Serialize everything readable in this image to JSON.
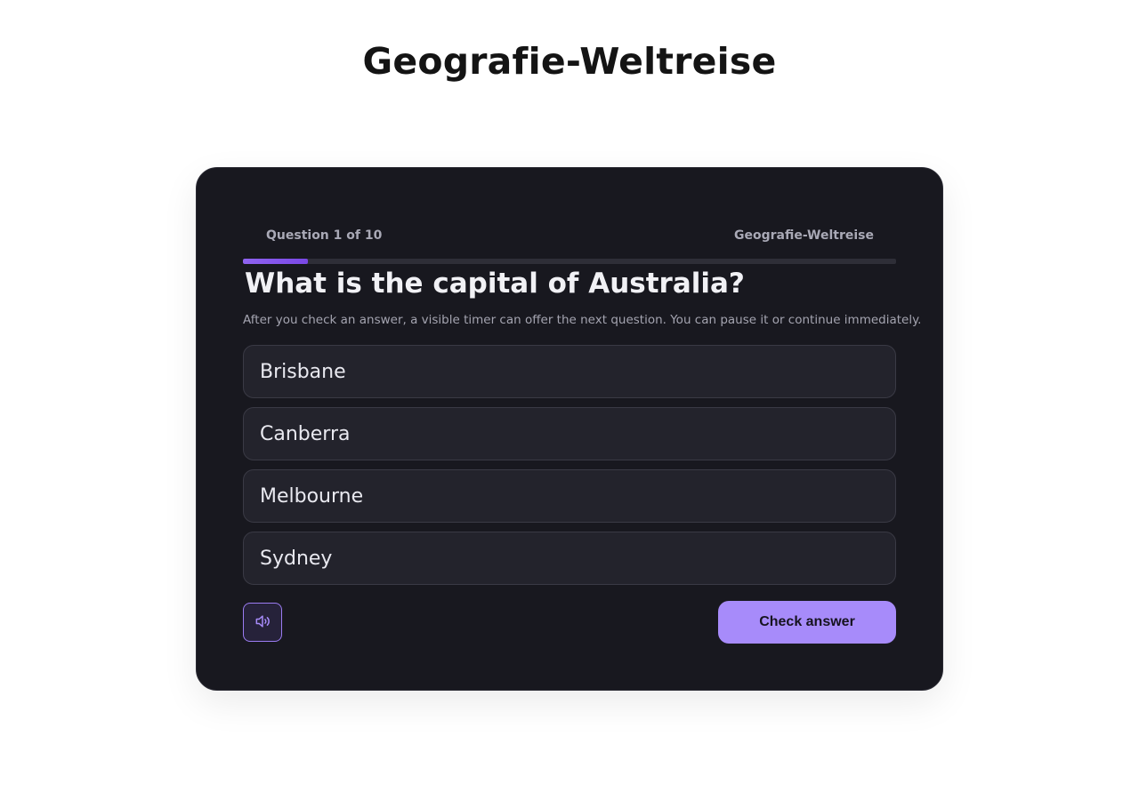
{
  "app": {
    "title": "Geografie-Weltreise"
  },
  "quiz": {
    "counter_text": "Question 1 of 10",
    "quiz_name": "Geografie-Weltreise",
    "progress_fraction": 0.1,
    "question": "What is the capital of Australia?",
    "hint": "After you check an answer, a visible timer can offer the next question. You can pause it or continue immediately.",
    "options": [
      {
        "label": "Brisbane"
      },
      {
        "label": "Canberra"
      },
      {
        "label": "Melbourne"
      },
      {
        "label": "Sydney"
      }
    ],
    "audio_icon": "speaker-icon",
    "check_label": "Check answer"
  },
  "colors": {
    "accent": "#a78bfa",
    "card_bg": "#18181f",
    "option_bg": "#23232c",
    "progress_fill": "#8b5cf6"
  }
}
